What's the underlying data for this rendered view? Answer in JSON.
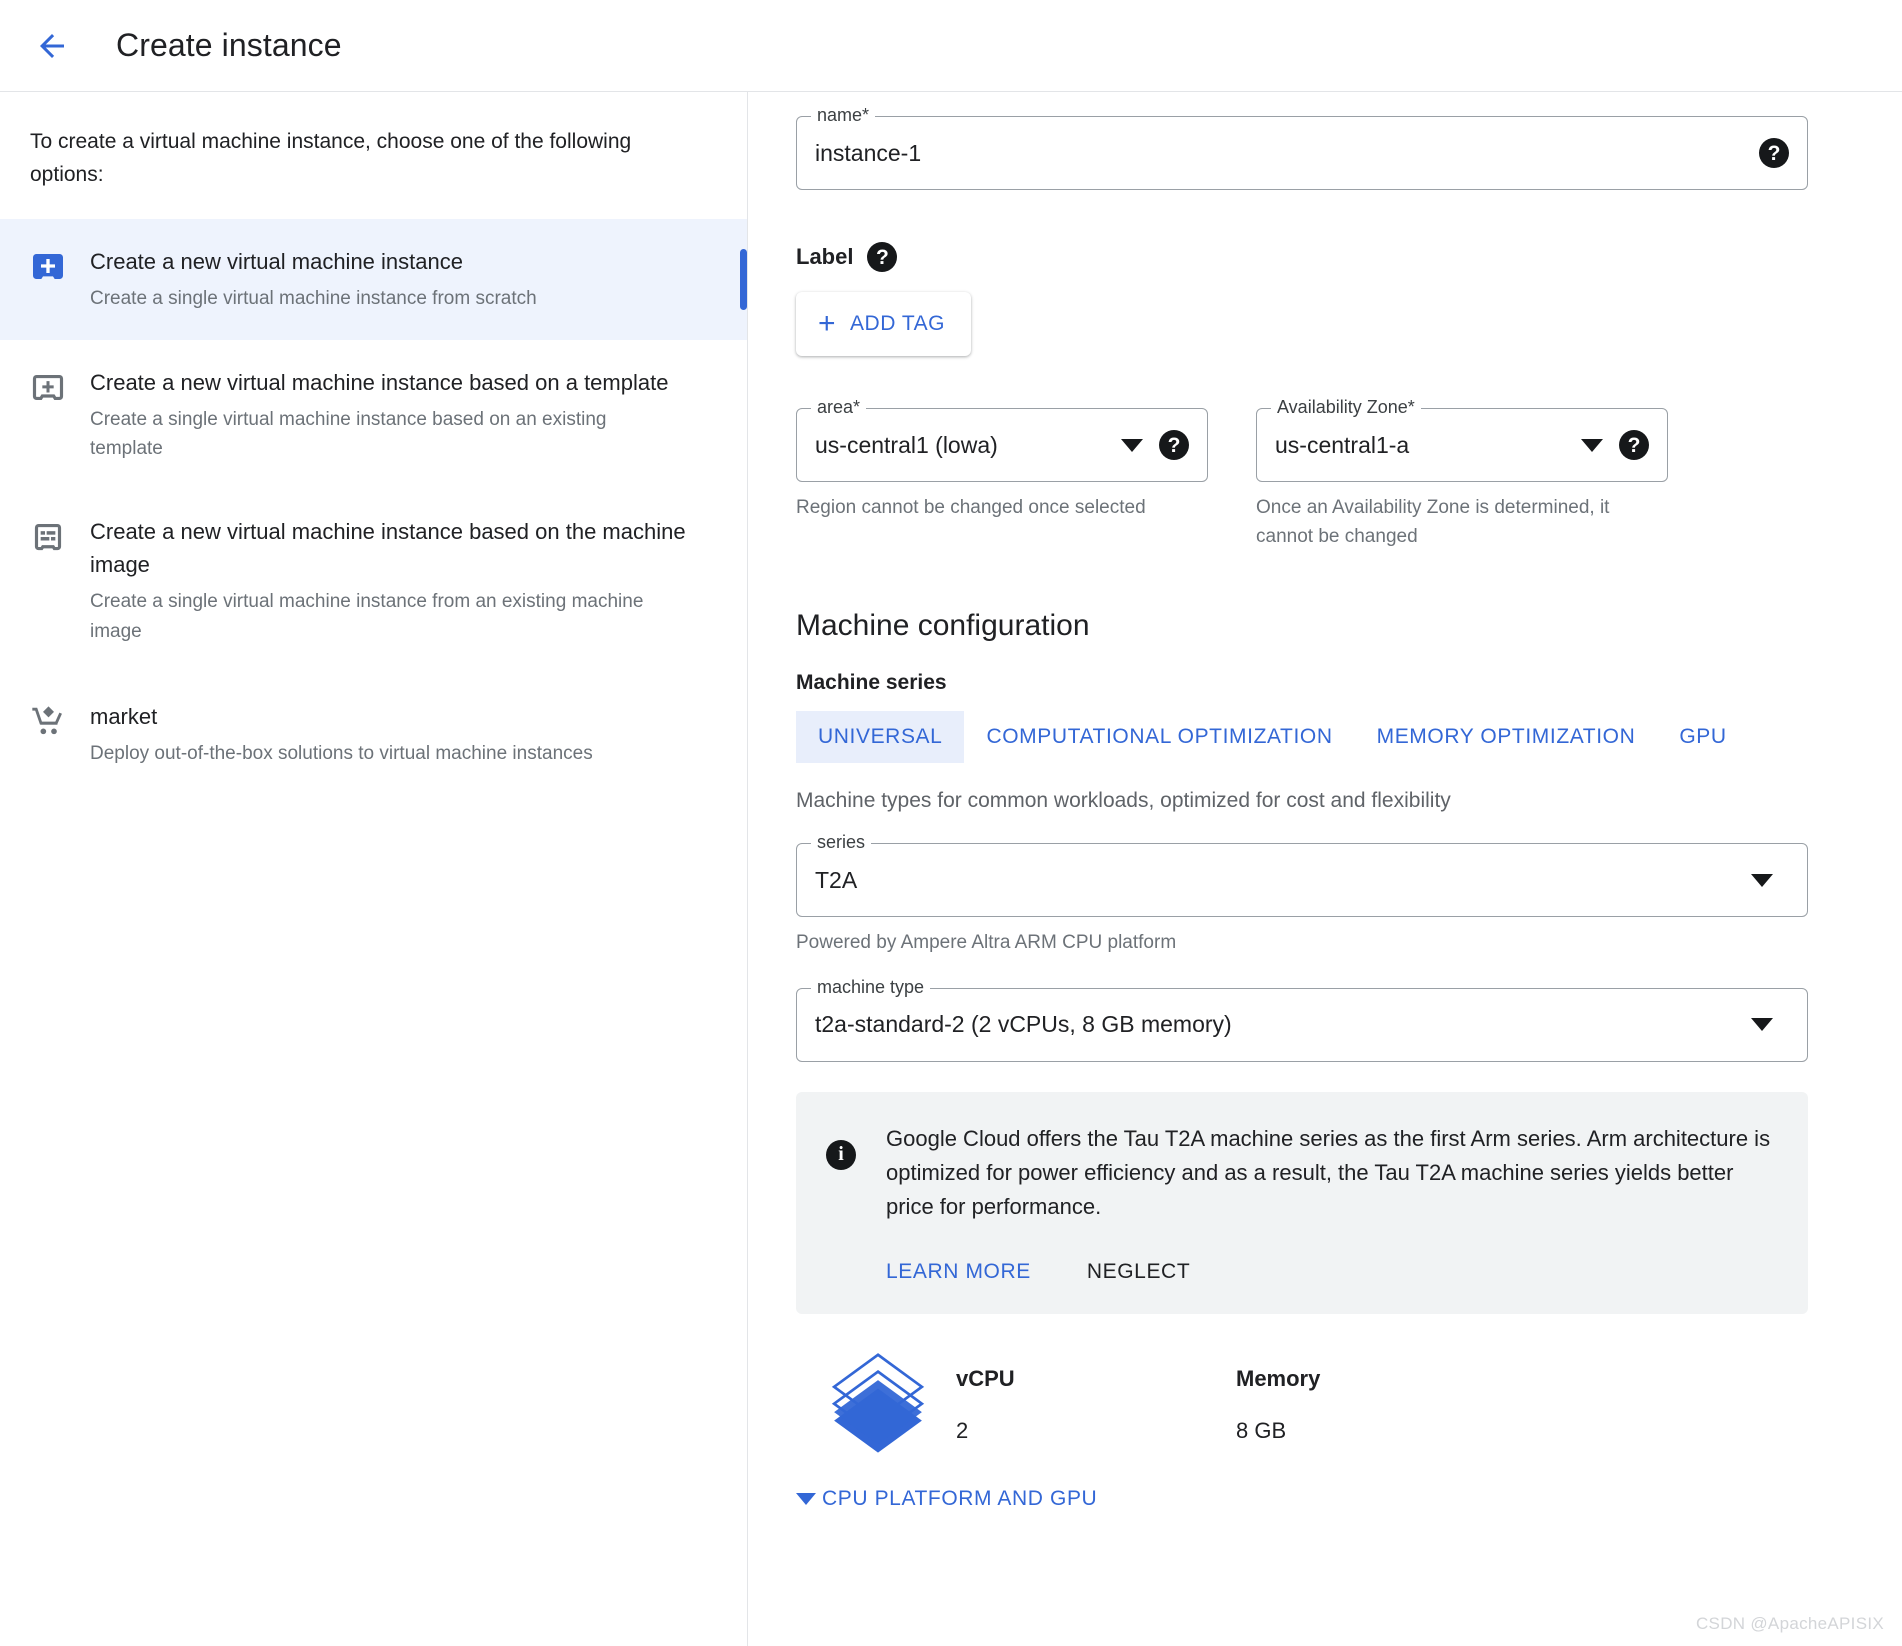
{
  "header": {
    "back_icon": "arrow-left-icon",
    "title": "Create instance"
  },
  "left_panel": {
    "intro": "To create a virtual machine instance, choose one of the following options:",
    "options": [
      {
        "icon": "vm-add-filled-icon",
        "title": "Create a new virtual machine instance",
        "desc": "Create a single virtual machine instance from scratch",
        "selected": true
      },
      {
        "icon": "vm-template-icon",
        "title": "Create a new virtual machine instance based on a template",
        "desc": "Create a single virtual machine instance based on an existing template",
        "selected": false
      },
      {
        "icon": "machine-image-icon",
        "title": "Create a new virtual machine instance based on the machine image",
        "desc": "Create a single virtual machine instance from an existing machine image",
        "selected": false
      },
      {
        "icon": "shopping-cart-icon",
        "title": "market",
        "desc": "Deploy out-of-the-box solutions to virtual machine instances",
        "selected": false
      }
    ]
  },
  "form": {
    "name_field": {
      "legend": "name*",
      "value": "instance-1",
      "help_icon": "help-icon"
    },
    "label_section": {
      "label": "Label",
      "help_icon": "help-icon",
      "add_tag_button": "ADD TAG",
      "plus_icon": "plus-icon"
    },
    "area_field": {
      "legend": "area*",
      "value": "us-central1 (lowa)",
      "hint": "Region cannot be changed once selected",
      "caret_icon": "chevron-down-icon",
      "help_icon": "help-icon"
    },
    "zone_field": {
      "legend": "Availability Zone*",
      "value": "us-central1-a",
      "hint": "Once an Availability Zone is determined, it cannot be changed",
      "caret_icon": "chevron-down-icon",
      "help_icon": "help-icon"
    }
  },
  "machine_config": {
    "section_title": "Machine configuration",
    "series_label": "Machine series",
    "tabs": [
      {
        "label": "UNIVERSAL",
        "active": true
      },
      {
        "label": "COMPUTATIONAL OPTIMIZATION",
        "active": false
      },
      {
        "label": "MEMORY OPTIMIZATION",
        "active": false
      },
      {
        "label": "GPU",
        "active": false
      }
    ],
    "tab_description": "Machine types for common workloads, optimized for cost and flexibility",
    "series_field": {
      "legend": "series",
      "value": "T2A",
      "hint": "Powered by Ampere Altra ARM CPU platform",
      "caret_icon": "chevron-down-icon"
    },
    "machine_type_field": {
      "legend": "machine type",
      "value": "t2a-standard-2 (2 vCPUs, 8 GB memory)",
      "caret_icon": "chevron-down-icon"
    },
    "info_box": {
      "icon": "info-icon",
      "text": "Google Cloud offers the Tau T2A machine series as the first Arm series. Arm architecture is optimized for power efficiency and as a result, the Tau T2A machine series yields better price for performance.",
      "learn_more": "LEARN MORE",
      "neglect": "NEGLECT"
    },
    "specs": {
      "icon": "layers-stack-icon",
      "vcpu_label": "vCPU",
      "vcpu_value": "2",
      "memory_label": "Memory",
      "memory_value": "8 GB"
    },
    "expander": {
      "label": "CPU PLATFORM AND GPU",
      "icon": "chevron-down-icon"
    }
  },
  "watermark": "CSDN @ApacheAPISIX",
  "colors": {
    "accent_blue": "#3367d6",
    "selected_row_bg": "#eef3fd",
    "tab_active_bg": "#e8eefb",
    "info_bg": "#f1f3f4",
    "muted_text": "#6c7278"
  }
}
